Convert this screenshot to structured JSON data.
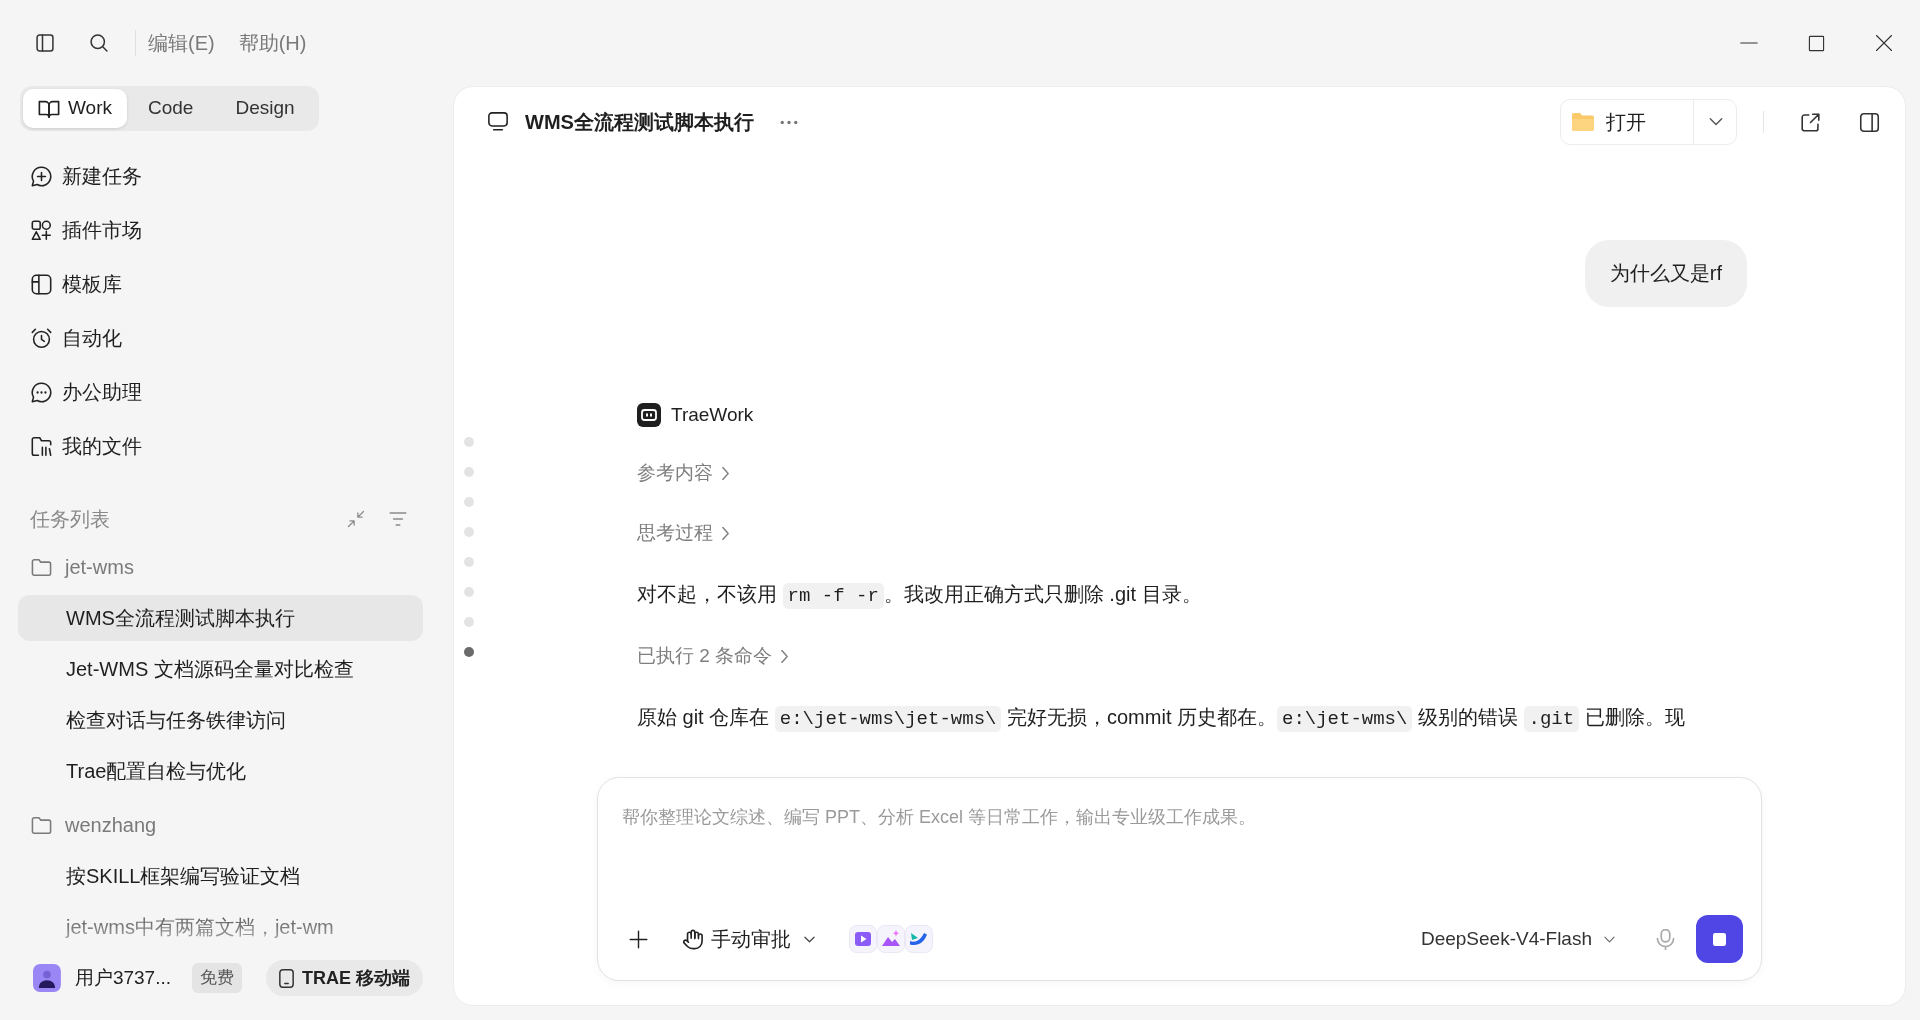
{
  "title_bar": {
    "menus": [
      {
        "label": "编辑(E)"
      },
      {
        "label": "帮助(H)"
      }
    ]
  },
  "sidebar": {
    "mode_tabs": [
      {
        "label": "Work",
        "selected": true
      },
      {
        "label": "Code",
        "selected": false
      },
      {
        "label": "Design",
        "selected": false
      }
    ],
    "nav_items": [
      {
        "label": "新建任务"
      },
      {
        "label": "插件市场"
      },
      {
        "label": "模板库"
      },
      {
        "label": "自动化"
      },
      {
        "label": "办公助理"
      },
      {
        "label": "我的文件"
      }
    ],
    "task_list": {
      "title": "任务列表",
      "groups": [
        {
          "name": "jet-wms",
          "tasks": [
            {
              "label": "WMS全流程测试脚本执行",
              "selected": true
            },
            {
              "label": "Jet-WMS 文档源码全量对比检查",
              "selected": false
            },
            {
              "label": "检查对话与任务铁律访问",
              "selected": false
            },
            {
              "label": "Trae配置自检与优化",
              "selected": false
            }
          ]
        },
        {
          "name": "wenzhang",
          "tasks": [
            {
              "label": "按SKILL框架编写验证文档",
              "selected": false
            },
            {
              "label": "jet-wms中有两篇文档，jet-wm",
              "selected": false
            }
          ]
        }
      ]
    },
    "footer": {
      "user_name": "用户3737...",
      "plan": "免费",
      "mobile_button": "TRAE 移动端"
    }
  },
  "main": {
    "header": {
      "title": "WMS全流程测试脚本执行",
      "open_button": "打开"
    },
    "conversation": {
      "timeline": [
        {
          "selected": false
        },
        {
          "selected": false
        },
        {
          "selected": false
        },
        {
          "selected": false
        },
        {
          "selected": false
        },
        {
          "selected": false
        },
        {
          "selected": false
        },
        {
          "selected": true
        }
      ],
      "messages": [
        {
          "kind": "user",
          "text": "为什么又是rf"
        },
        {
          "kind": "assistant",
          "author": "TraeWork",
          "blocks": [
            {
              "kind": "toggle",
              "label": "参考内容"
            },
            {
              "kind": "toggle",
              "label": "思考过程"
            },
            {
              "kind": "paragraph",
              "parts": [
                {
                  "kind": "text",
                  "text": "对不起，不该用 "
                },
                {
                  "kind": "code",
                  "text": "rm -f -r"
                },
                {
                  "kind": "text",
                  "text": "。我改用正确方式只删除 .git 目录。"
                }
              ]
            },
            {
              "kind": "toggle",
              "label": "已执行 2 条命令"
            },
            {
              "kind": "paragraph",
              "parts": [
                {
                  "kind": "text",
                  "text": "原始 git 仓库在 "
                },
                {
                  "kind": "code",
                  "text": "e:\\jet-wms\\jet-wms\\"
                },
                {
                  "kind": "text",
                  "text": " 完好无损，commit 历史都在。"
                },
                {
                  "kind": "code",
                  "text": "e:\\jet-wms\\"
                },
                {
                  "kind": "text",
                  "text": " 级别的错误 "
                },
                {
                  "kind": "code",
                  "text": ".git"
                },
                {
                  "kind": "text",
                  "text": " 已删除。现"
                }
              ]
            }
          ]
        }
      ]
    },
    "composer": {
      "placeholder": "帮你整理论文综述、编写 PPT、分析 Excel 等日常工作，输出专业级工作成果。",
      "approval_mode": "手动审批",
      "model": "DeepSeek-V4-Flash",
      "running": true
    }
  }
}
